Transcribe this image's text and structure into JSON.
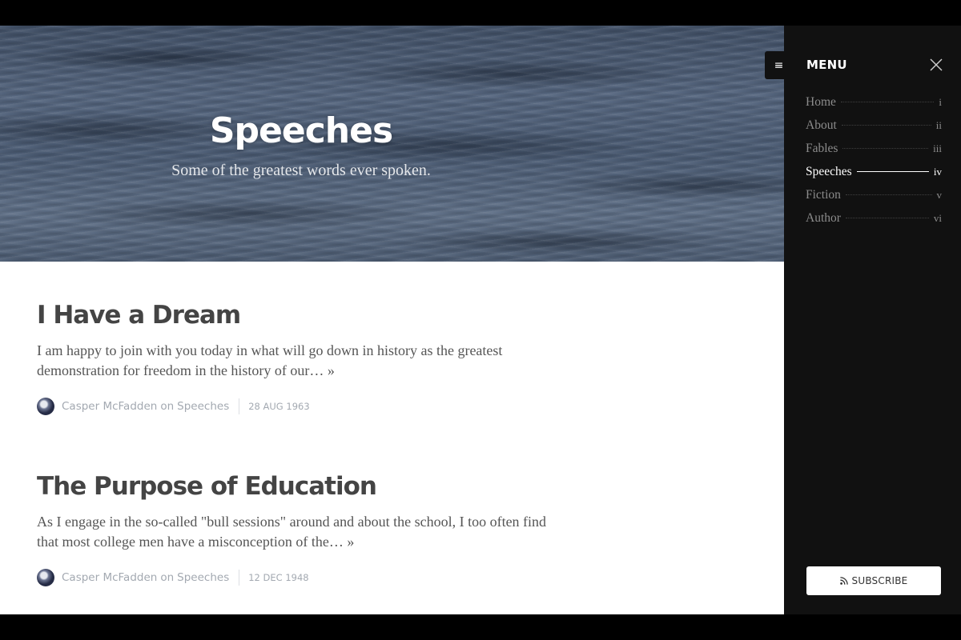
{
  "hero": {
    "title": "Speeches",
    "subtitle": "Some of the greatest words ever spoken."
  },
  "posts": [
    {
      "title": "I Have a Dream",
      "excerpt": "I am happy to join with you today in what will go down in history as the greatest demonstration for freedom in the history of our…",
      "read_more": "»",
      "author": "Casper McFadden",
      "on": "on",
      "tag": "Speeches",
      "date": "28 AUG 1963"
    },
    {
      "title": "The Purpose of Education",
      "excerpt": "As I engage in the so-called \"bull sessions\" around and about the school, I too often find that most college men have a misconception of the…",
      "read_more": "»",
      "author": "Casper McFadden",
      "on": "on",
      "tag": "Speeches",
      "date": "12 DEC 1948"
    }
  ],
  "menu": {
    "toggle_icon": "hamburger-icon",
    "heading": "MENU",
    "close_icon": "close-icon",
    "items": [
      {
        "label": "Home",
        "num": "i",
        "active": false
      },
      {
        "label": "About",
        "num": "ii",
        "active": false
      },
      {
        "label": "Fables",
        "num": "iii",
        "active": false
      },
      {
        "label": "Speeches",
        "num": "iv",
        "active": true
      },
      {
        "label": "Fiction",
        "num": "v",
        "active": false
      },
      {
        "label": "Author",
        "num": "vi",
        "active": false
      }
    ],
    "subscribe_label": "SUBSCRIBE",
    "subscribe_icon": "rss-icon"
  },
  "colors": {
    "sidebar_bg": "#111111",
    "title_text": "#444444",
    "meta_text": "#a3a9b1",
    "menu_text": "#8c8c8c",
    "menu_active": "#ffffff"
  }
}
